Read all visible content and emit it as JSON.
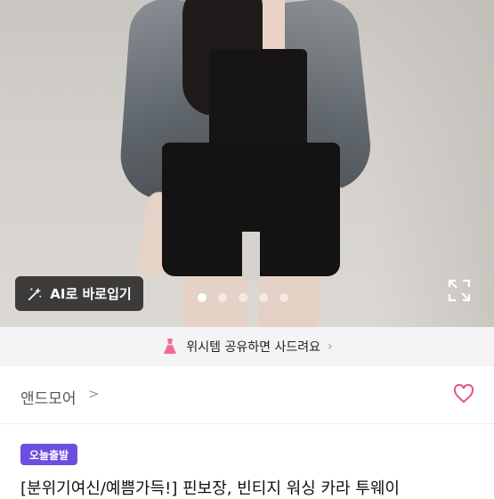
{
  "product_image": {
    "ai_button_label": "AI로 바로입기",
    "carousel_total": 5,
    "carousel_active": 1
  },
  "wish_banner": {
    "text": "위시템 공유하면 사드려요"
  },
  "shop": {
    "name": "앤드모어",
    "chevron": ">"
  },
  "listing": {
    "badge": "오늘출발",
    "title": "[분위기여신/예쁨가득!] 핀보장, 빈티지 워싱 카라 투웨이"
  },
  "colors": {
    "badge_bg": "#6b4fe0",
    "heart": "#e05a7a",
    "dress": "#f06b9a"
  }
}
